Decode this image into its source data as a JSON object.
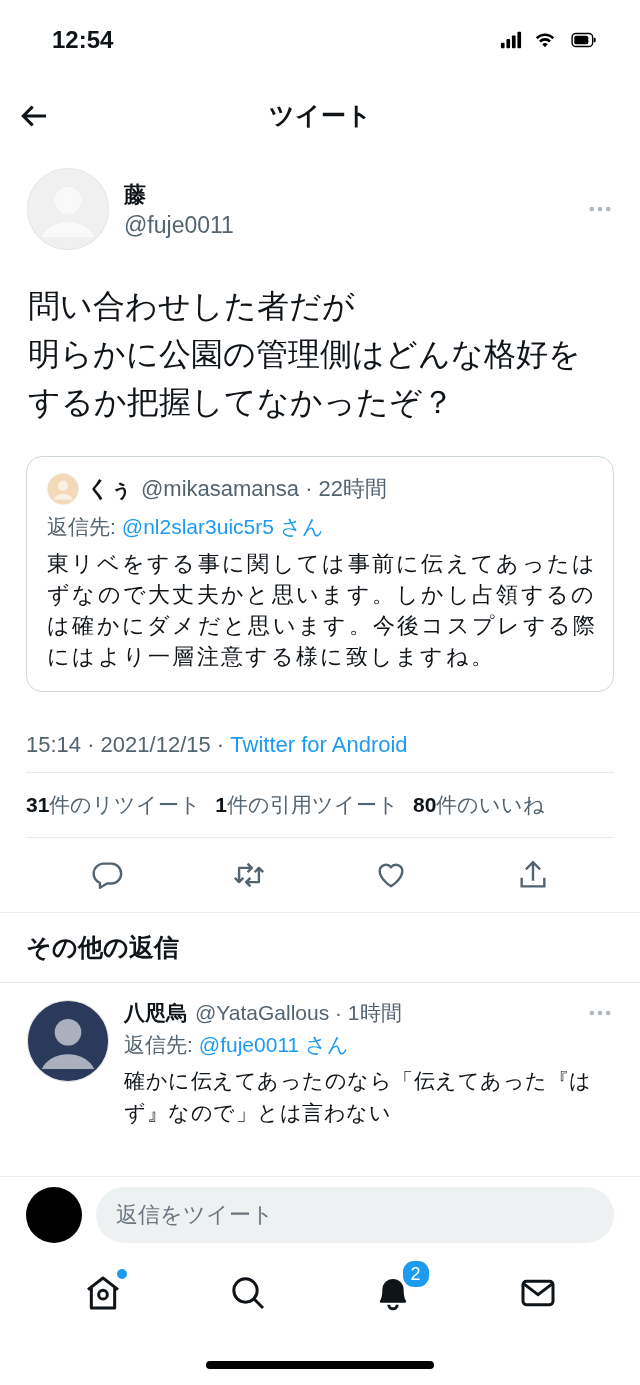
{
  "status_bar": {
    "time": "12:54"
  },
  "header": {
    "title": "ツイート"
  },
  "tweet": {
    "name": "藤",
    "handle": "@fuje0011",
    "text": [
      "問い合わせした者だが",
      "明らかに公園の管理側はどんな格好をするか把握してなかったぞ？"
    ],
    "quote": {
      "name": "くぅ",
      "handle": "@mikasamansa",
      "separator": "·",
      "time": "22時間",
      "reply_label": "返信先:",
      "reply_to": "@nl2slar3uic5r5 さん",
      "text": "東リベをする事に関しては事前に伝えてあったはずなので大丈夫かと思います。しかし占領するのは確かにダメだと思います。今後コスプレする際にはより一層注意する様に致しますね。"
    },
    "meta": "15:14 · 2021/12/15 · ",
    "source": "Twitter for Android",
    "stats": [
      {
        "count": "31",
        "label": "件のリツイート"
      },
      {
        "count": "1",
        "label": "件の引用ツイート"
      },
      {
        "count": "80",
        "label": "件のいいね"
      }
    ],
    "actions": [
      {
        "kind": "reply"
      },
      {
        "kind": "retweet"
      },
      {
        "kind": "like"
      },
      {
        "kind": "share"
      }
    ]
  },
  "replies_title": "その他の返信",
  "replies": [
    {
      "name": "八咫烏",
      "handle": "@YataGallous",
      "separator": "·",
      "time": "1時間",
      "reply_label": "返信先:",
      "reply_to": "@fuje0011 さん",
      "text": "確かに伝えてあったのなら「伝えてあった『はず』なので」とは言わない"
    }
  ],
  "composer": {
    "placeholder": "返信をツイート"
  },
  "tabs": [
    {
      "kind": "home",
      "selected": false,
      "dot": true
    },
    {
      "kind": "search",
      "selected": false,
      "dot": false
    },
    {
      "kind": "notifications",
      "selected": true,
      "dot": false,
      "badge": "2"
    },
    {
      "kind": "messages",
      "selected": false,
      "dot": false
    }
  ]
}
